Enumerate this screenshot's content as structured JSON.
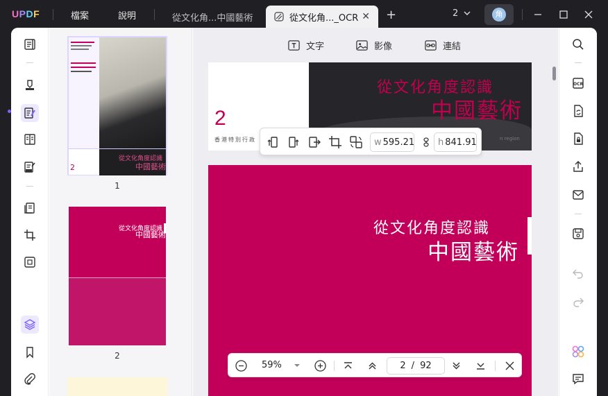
{
  "app": {
    "logo": "UPDF",
    "menu": [
      "檔案",
      "說明"
    ]
  },
  "tabs": [
    {
      "label": "從文化角...中國藝術",
      "active": false
    },
    {
      "label": "從文化角..._OCR",
      "active": true
    }
  ],
  "titlebar": {
    "page_count": "2",
    "avatar_initial": "角"
  },
  "view_tabs": [
    {
      "label": "文字",
      "icon": "text-icon"
    },
    {
      "label": "影像",
      "icon": "image-icon"
    },
    {
      "label": "連結",
      "icon": "link-icon"
    }
  ],
  "thumbnails": [
    {
      "label": "1"
    },
    {
      "label": "2"
    }
  ],
  "pages": {
    "page1": {
      "title_line1": "從文化角度認識",
      "title_line2": "中國藝術",
      "number": "2",
      "subtitle": "香港特別行政",
      "corner_text": "n region"
    },
    "page2": {
      "title_line1": "從文化角度認識",
      "title_line2": "中國藝術"
    },
    "thumb1": {
      "title_line1": "從文化角度認識",
      "title_line2": "中國藝術",
      "number": "2"
    },
    "thumb2": {
      "title_line1": "從文化角度認識",
      "title_line2": "中國藝術"
    }
  },
  "edit_bar": {
    "width_label": "w",
    "width_value": "595.21",
    "height_label": "h",
    "height_value": "841.91"
  },
  "zoom_bar": {
    "zoom_value": "59%",
    "current_page": "2",
    "page_separator": "/",
    "total_pages": "92"
  },
  "colors": {
    "accent": "#7b61ff",
    "magenta": "#c2005a",
    "titlebar": "#1f1f24"
  }
}
